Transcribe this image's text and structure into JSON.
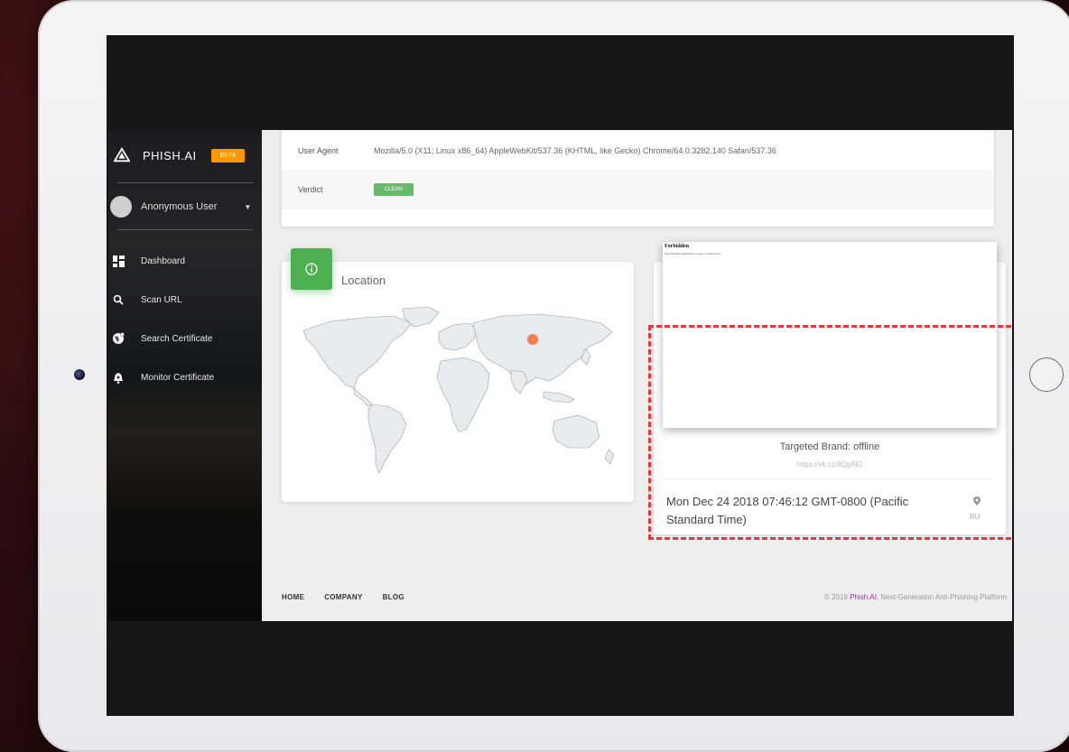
{
  "app": {
    "name": "PHISH.AI",
    "badge": "BETA"
  },
  "user": {
    "name": "Anonymous User"
  },
  "nav": [
    {
      "label": "Dashboard",
      "icon": "dashboard-icon"
    },
    {
      "label": "Scan URL",
      "icon": "search-icon"
    },
    {
      "label": "Search Certificate",
      "icon": "globe-icon"
    },
    {
      "label": "Monitor Certificate",
      "icon": "bell-icon"
    }
  ],
  "details": {
    "user_agent_label": "User Agent",
    "user_agent_value": "Mozilla/5.0 (X11; Linux x86_64) AppleWebKit/537.36 (KHTML, like Gecko) Chrome/64.0.3282.140 Safari/537.36",
    "verdict_label": "Verdict",
    "verdict_value": "CLEAN"
  },
  "location": {
    "title": "Location",
    "marker_color": "#f08050"
  },
  "preview": {
    "page_title": "Forbidden",
    "page_text": "You don't have permission to access / on this server.",
    "targeted_brand": "Targeted Brand: offline",
    "url": "https://vk.cc/8QgiND",
    "date": "Mon Dec 24 2018 07:46:12 GMT-0800 (Pacific Standard Time)",
    "country": "RU"
  },
  "footer": {
    "links": [
      "HOME",
      "COMPANY",
      "BLOG"
    ],
    "copyright_prefix": "© 2018 ",
    "copyright_brand": "Phish.AI",
    "copyright_suffix": ", Next-Generation Anti-Phishing Platform"
  },
  "colors": {
    "accent_green": "#4caf50",
    "beta_orange": "#ff9800",
    "highlight_red": "#e53935"
  }
}
